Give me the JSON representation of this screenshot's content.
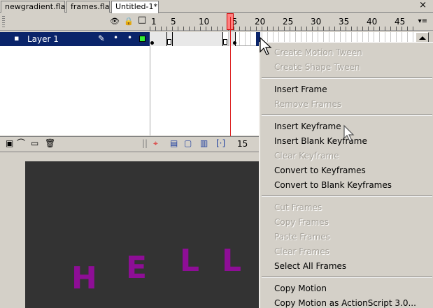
{
  "tabs": [
    {
      "label": "newgradient.fla"
    },
    {
      "label": "frames.fla"
    },
    {
      "label": "Untitled-1*"
    }
  ],
  "window": {
    "close_glyph": "×"
  },
  "timeline": {
    "header_icons": {
      "eye": "👁",
      "lock": "🔒",
      "outline": "□"
    },
    "ruler": [
      "1",
      "5",
      "10",
      "15",
      "20",
      "25",
      "30",
      "35",
      "40",
      "45"
    ],
    "layer": {
      "name": "Layer 1",
      "outline_color": "#33ee33"
    },
    "current_frame": "15",
    "accent": "#0a246a",
    "playhead_color": "#ff8080"
  },
  "stage": {
    "background": "#333333",
    "letters": [
      "H",
      "E",
      "L",
      "L"
    ],
    "letter_color": "#8e0e96"
  },
  "context_menu": {
    "items": [
      {
        "label": "Create Motion Tween",
        "enabled": false
      },
      {
        "label": "Create Shape Tween",
        "enabled": false
      },
      {
        "label": "Insert Frame",
        "enabled": true
      },
      {
        "label": "Remove Frames",
        "enabled": false
      },
      {
        "label": "Insert Keyframe",
        "enabled": true
      },
      {
        "label": "Insert Blank Keyframe",
        "enabled": true
      },
      {
        "label": "Clear Keyframe",
        "enabled": false
      },
      {
        "label": "Convert to Keyframes",
        "enabled": true
      },
      {
        "label": "Convert to Blank Keyframes",
        "enabled": true
      },
      {
        "label": "Cut Frames",
        "enabled": false
      },
      {
        "label": "Copy Frames",
        "enabled": false
      },
      {
        "label": "Paste Frames",
        "enabled": false
      },
      {
        "label": "Clear Frames",
        "enabled": false
      },
      {
        "label": "Select All Frames",
        "enabled": true
      },
      {
        "label": "Copy Motion",
        "enabled": true
      },
      {
        "label": "Copy Motion as ActionScript 3.0...",
        "enabled": true
      }
    ]
  }
}
